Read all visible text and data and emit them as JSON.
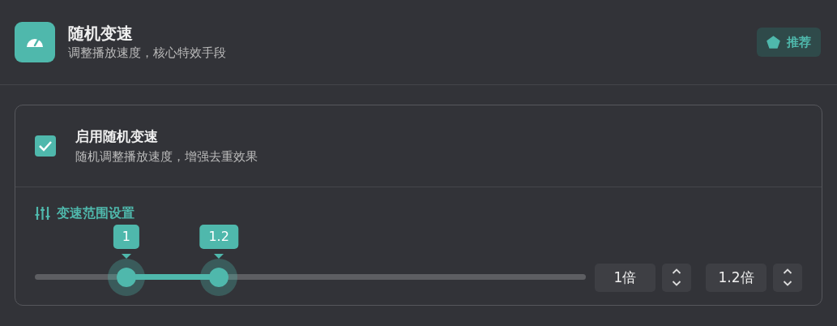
{
  "header": {
    "title": "随机变速",
    "subtitle": "调整播放速度，核心特效手段",
    "badge": "推荐"
  },
  "enable": {
    "label": "启用随机变速",
    "description": "随机调整播放速度，增强去重效果",
    "checked": true
  },
  "range": {
    "heading": "变速范围设置",
    "thumbs": [
      {
        "tooltip": "1",
        "level": 0.166
      },
      {
        "tooltip": "1.2",
        "level": 0.334
      }
    ],
    "inputs": [
      {
        "value": "1倍"
      },
      {
        "value": "1.2倍"
      }
    ]
  }
}
